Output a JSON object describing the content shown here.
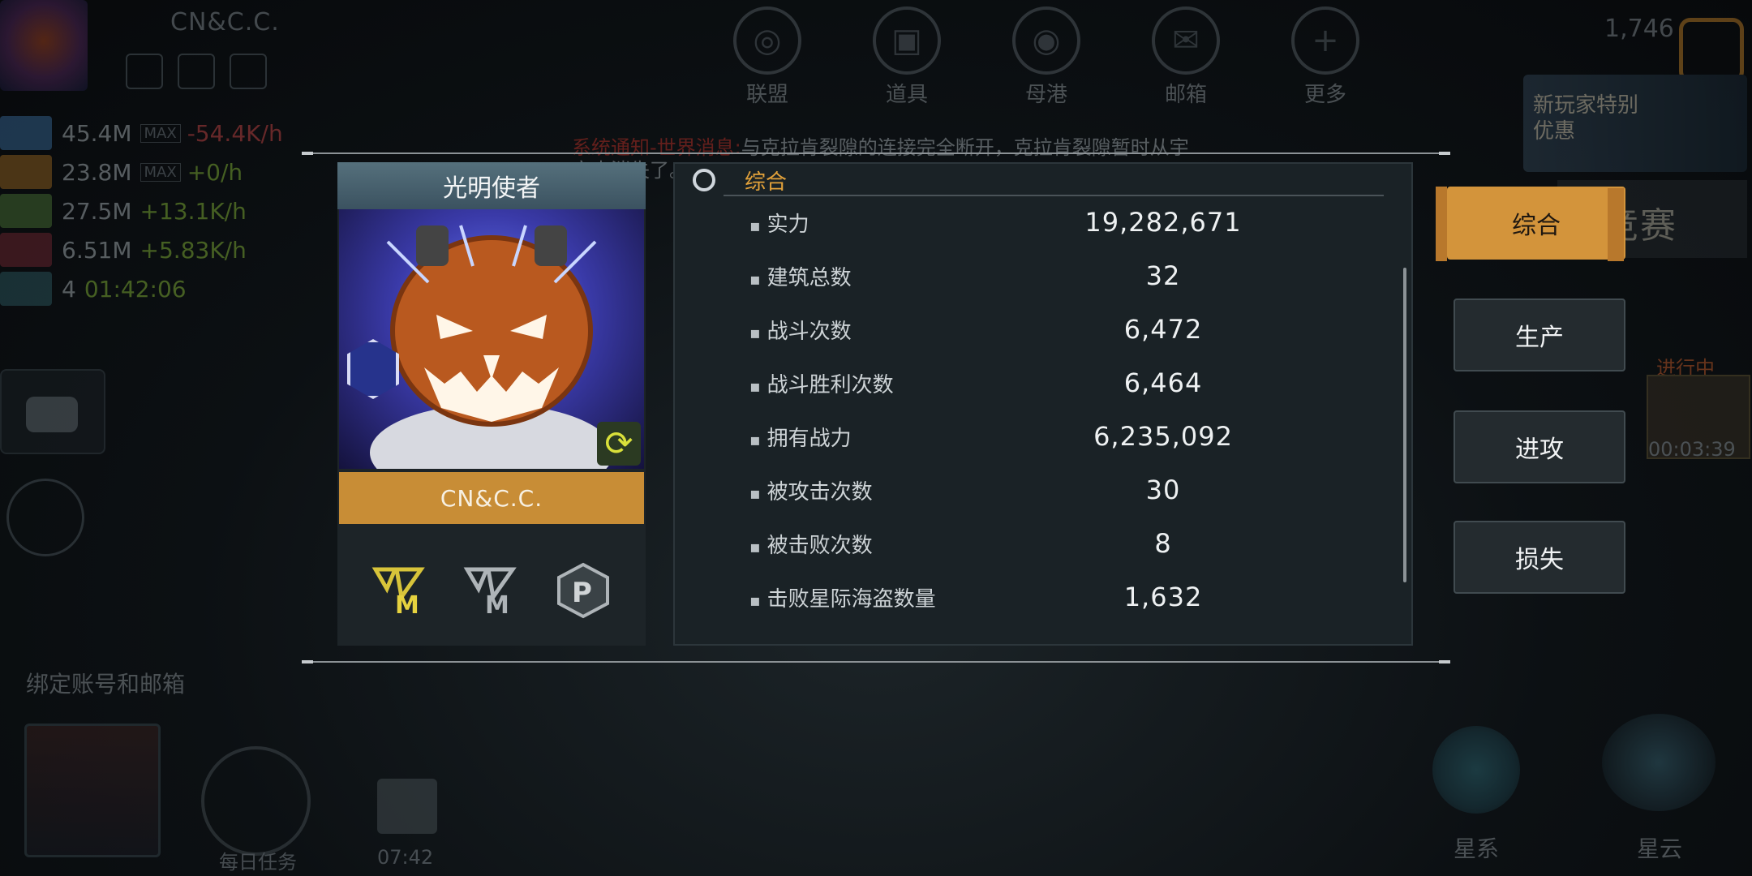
{
  "hud": {
    "player_name": "CN&C.C.",
    "resources": [
      {
        "icon": "crystal-shard-icon",
        "amount": "45.4M",
        "max": "MAX",
        "rate": "-54.4K/h",
        "trend": "neg",
        "color": "#3a6fa0"
      },
      {
        "icon": "gas-flame-icon",
        "amount": "23.8M",
        "max": "MAX",
        "rate": "+0/h",
        "trend": "pos",
        "color": "#a06a22"
      },
      {
        "icon": "mineral-icon",
        "amount": "27.5M",
        "max": "",
        "rate": "+13.1K/h",
        "trend": "pos",
        "color": "#4f7a38"
      },
      {
        "icon": "alloy-stack-icon",
        "amount": "6.51M",
        "max": "",
        "rate": "+5.83K/h",
        "trend": "pos",
        "color": "#7a2a35"
      },
      {
        "icon": "eye-icon",
        "amount": "4",
        "max": "",
        "rate": "01:42:06",
        "trend": "pos",
        "color": "#2f5f66"
      }
    ],
    "bind_label": "绑定账号和邮箱",
    "daily_task_label": "每日任务",
    "gift_timer": "07:42",
    "currency_amount": "1,746",
    "promo_text": "新玩家特别优惠",
    "event_text": "备竞赛",
    "progress_label": "进行中",
    "progress_timer": "00:03:39",
    "planet_labels": [
      "星系",
      "星云"
    ],
    "broadcast_warn": "系统通知-世界消息:",
    "broadcast_text": "与克拉肯裂隙的连接完全断开，克拉肯裂隙暂时从宇宙中消失了。"
  },
  "top_nav": [
    {
      "label": "联盟",
      "icon": "globe-icon"
    },
    {
      "label": "道具",
      "icon": "toolbox-icon"
    },
    {
      "label": "母港",
      "icon": "helmet-icon"
    },
    {
      "label": "邮箱",
      "icon": "mail-icon"
    },
    {
      "label": "更多",
      "icon": "plus-icon"
    }
  ],
  "profile": {
    "title": "光明使者",
    "name": "CN&C.C.",
    "badges": [
      "rank-m-gold-badge-icon",
      "rank-m-silver-badge-icon",
      "p-hexagon-badge-icon"
    ]
  },
  "stats": {
    "section_title": "综合",
    "rows": [
      {
        "label": "实力",
        "value": "19,282,671"
      },
      {
        "label": "建筑总数",
        "value": "32"
      },
      {
        "label": "战斗次数",
        "value": "6,472"
      },
      {
        "label": "战斗胜利次数",
        "value": "6,464"
      },
      {
        "label": "拥有战力",
        "value": "6,235,092"
      },
      {
        "label": "被攻击次数",
        "value": "30"
      },
      {
        "label": "被击败次数",
        "value": "8"
      },
      {
        "label": "击败星际海盗数量",
        "value": "1,632"
      }
    ]
  },
  "tabs": [
    {
      "label": "综合",
      "active": true
    },
    {
      "label": "生产",
      "active": false
    },
    {
      "label": "进攻",
      "active": false
    },
    {
      "label": "损失",
      "active": false
    }
  ],
  "colors": {
    "accent": "#d3943b",
    "panel": "#1a2226",
    "title_bar": "#4a6470"
  }
}
